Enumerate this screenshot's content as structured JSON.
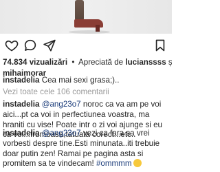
{
  "post": {
    "stats": {
      "views_count": "74.834",
      "views_label": "vizualizări",
      "appreciation_prefix": "Apreciată de",
      "appreciated_by": "lucianssss",
      "conjunction": "și",
      "appreciated_by_2": "mihaimorar"
    },
    "caption": {
      "username": "instadelia",
      "text": "Cea mai sexi grasa;).."
    },
    "view_comments_label": "Vezi toate cele 106 comentarii",
    "comments": [
      {
        "username": "instadelia",
        "mention": "@ang23o7",
        "text": "noroc ca va am pe voi aici...pt ca  voi in perfectiunea voastra, ma hraniti cu vise! Poate intr o zi voi ajunge si eu ca voi...frumoasa,tatuata corect...etc.."
      },
      {
        "username": "instadelia",
        "mention": "@ang23o7",
        "text": "vezi ca fara sa vrei vorbesti despre tine.Esti minunata..iti trebuie doar putin zen! Ramai pe pagina asta si promitem sa te vindecam!",
        "hashtag": "#ommmm"
      }
    ]
  },
  "icons": {
    "like": "heart-outline-icon",
    "comment": "comment-bubble-icon",
    "share": "send-paper-plane-icon",
    "save": "bookmark-outline-icon"
  },
  "colors": {
    "text": "#262626",
    "muted": "#9a9a9a",
    "link": "#1b3c7a"
  }
}
